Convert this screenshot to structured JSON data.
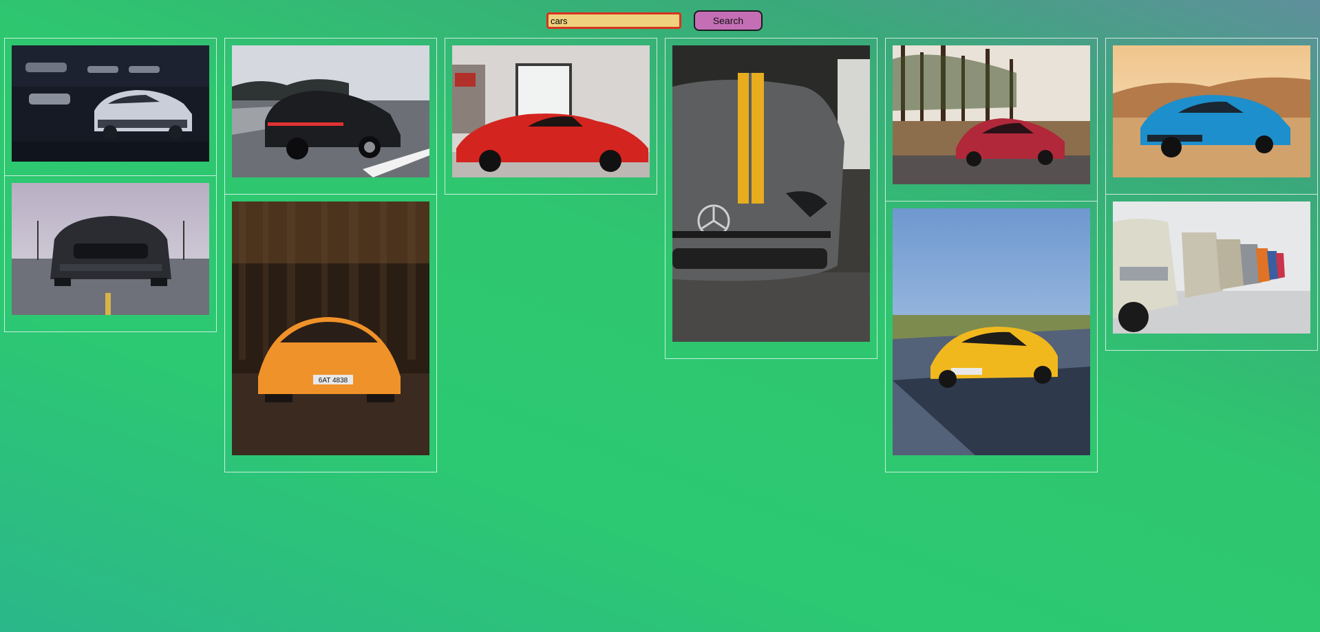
{
  "search": {
    "value": "cars",
    "button_label": "Search"
  },
  "gallery": {
    "columns": [
      [
        {
          "subject": "white-camaro-garage"
        },
        {
          "subject": "black-mustang-front"
        }
      ],
      [
        {
          "subject": "black-porsche-highway"
        },
        {
          "subject": "orange-lamborghini-forest",
          "plate": "6AT 4838"
        }
      ],
      [
        {
          "subject": "red-ferrari-showroom"
        }
      ],
      [
        {
          "subject": "grey-mercedes-yellow-stripe"
        }
      ],
      [
        {
          "subject": "red-mercedes-forest"
        },
        {
          "subject": "yellow-mercedes-amg-road"
        }
      ],
      [
        {
          "subject": "blue-camaro-desert"
        },
        {
          "subject": "vintage-bmw-row"
        }
      ]
    ]
  }
}
